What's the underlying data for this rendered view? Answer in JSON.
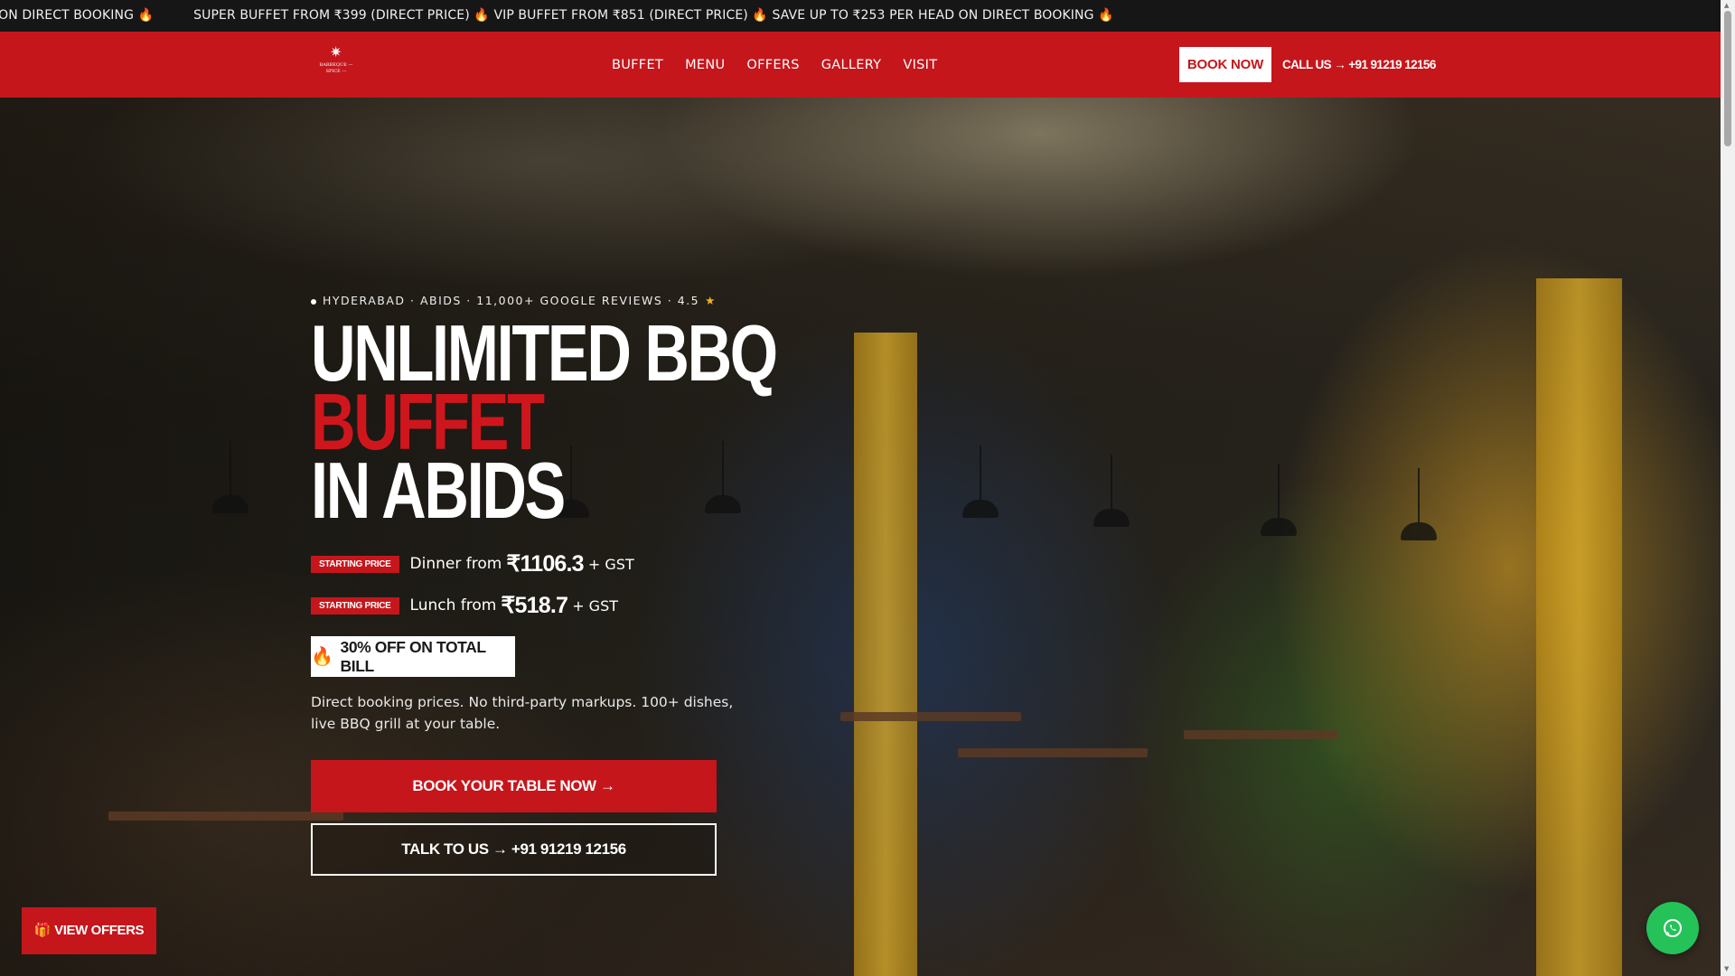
{
  "ticker": {
    "items": [
      "SAVE UP TO ₹253 PER HEAD ON DIRECT BOOKING",
      "SUPER BUFFET FROM ₹399 (DIRECT PRICE)",
      "VIP BUFFET FROM ₹851 (DIRECT PRICE)",
      "SAVE UP TO ₹253 PER HEAD ON DIRECT BOOKING"
    ],
    "flame": "🔥"
  },
  "navbar": {
    "logo_mark": "✷",
    "logo_text": "BARBEQUE — SPICE —",
    "links": [
      "BUFFET",
      "MENU",
      "OFFERS",
      "GALLERY",
      "VISIT"
    ],
    "book_now": "BOOK NOW",
    "call": "CALL US → +91 91219 12156"
  },
  "hero": {
    "location": "HYDERABAD · ABIDS · 11,000+ GOOGLE REVIEWS · 4.5",
    "rating_star": "★",
    "title_line1": "UNLIMITED BBQ",
    "title_line2": "BUFFET",
    "title_line3": "IN ABIDS",
    "prices": [
      {
        "badge": "STARTING PRICE",
        "label": "Dinner from",
        "amount": "₹1106.3",
        "suffix": "+ GST"
      },
      {
        "badge": "STARTING PRICE",
        "label": "Lunch from",
        "amount": "₹518.7",
        "suffix": "+ GST"
      }
    ],
    "discount_icon": "🔥",
    "discount": "30% OFF ON TOTAL BILL",
    "description": "Direct booking prices. No third-party markups. 100+ dishes, live BBQ grill at your table.",
    "cta_primary": "BOOK YOUR TABLE NOW →",
    "cta_secondary": "TALK TO US → +91 91219 12156"
  },
  "floating": {
    "view_offers_icon": "🎁",
    "view_offers": "VIEW OFFERS",
    "whatsapp_icon": "whatsapp-icon"
  },
  "colors": {
    "brand_red": "#c5161c",
    "ticker_bg": "#161616",
    "whatsapp_green": "#25c25a",
    "rating_star": "#f5b323"
  }
}
